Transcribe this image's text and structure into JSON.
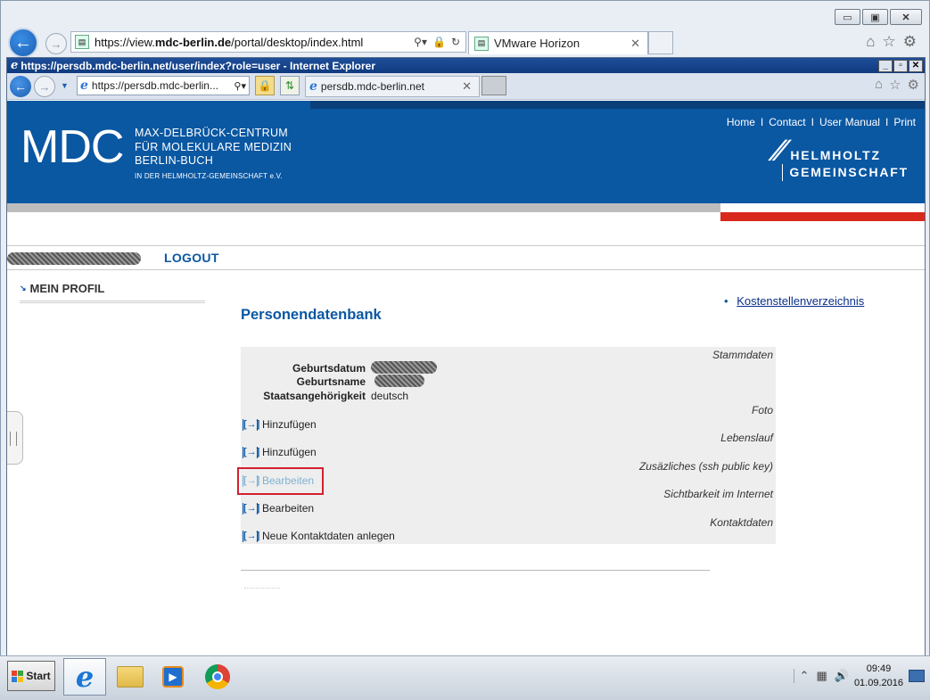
{
  "outer_browser": {
    "url": "https://view.mdc-berlin.de/portal/desktop/index.html",
    "url_prefix": "https://view.",
    "url_domain": "mdc-berlin.de",
    "url_path": "/portal/desktop/index.html",
    "tab_title": "VMware Horizon"
  },
  "inner_browser": {
    "window_title": "https://persdb.mdc-berlin.net/user/index?role=user - Internet Explorer",
    "address": "https://persdb.mdc-berlin...",
    "tab_title": "persdb.mdc-berlin.net"
  },
  "header": {
    "logo": "MDC",
    "institute_lines": [
      "MAX-DELBRÜCK-CENTRUM",
      "FÜR MOLEKULARE MEDIZIN",
      "BERLIN-BUCH"
    ],
    "institute_small": "IN DER HELMHOLTZ-GEMEINSCHAFT e.V.",
    "top_links": [
      "Home",
      "Contact",
      "User Manual",
      "Print"
    ],
    "separator": "I",
    "helmholtz_line1": "HELMHOLTZ",
    "helmholtz_line2": "GEMEINSCHAFT"
  },
  "login_bar": {
    "logout": "LOGOUT"
  },
  "sidebar": {
    "items": [
      {
        "label": "MEIN PROFIL"
      }
    ]
  },
  "main": {
    "title": "Personendatenbank",
    "right_link": "Kostenstellenverzeichnis",
    "sections": {
      "stammdaten": "Stammdaten",
      "foto": "Foto",
      "lebenslauf": "Lebenslauf",
      "zusaetzliches": "Zusäzliches (ssh public key)",
      "sichtbarkeit": "Sichtbarkeit im Internet",
      "kontaktdaten": "Kontaktdaten"
    },
    "fields": {
      "geburtsdatum": "Geburtsdatum",
      "geburtsname": "Geburtsname",
      "staatsangehoerigkeit": "Staatsangehörigkeit",
      "staatsangehoerigkeit_value": "deutsch"
    },
    "actions": {
      "hinzufuegen_1": "Hinzufügen",
      "hinzufuegen_2": "Hinzufügen",
      "bearbeiten_1": "Bearbeiten",
      "bearbeiten_2": "Bearbeiten",
      "neue_kontaktdaten": "Neue Kontaktdaten anlegen",
      "icon": "[→]"
    }
  },
  "taskbar": {
    "start": "Start",
    "time": "09:49",
    "date": "01.09.2016"
  },
  "colors": {
    "mdc_blue": "#0a57a2",
    "accent_red": "#d9291c",
    "highlight_red": "#d32030"
  }
}
